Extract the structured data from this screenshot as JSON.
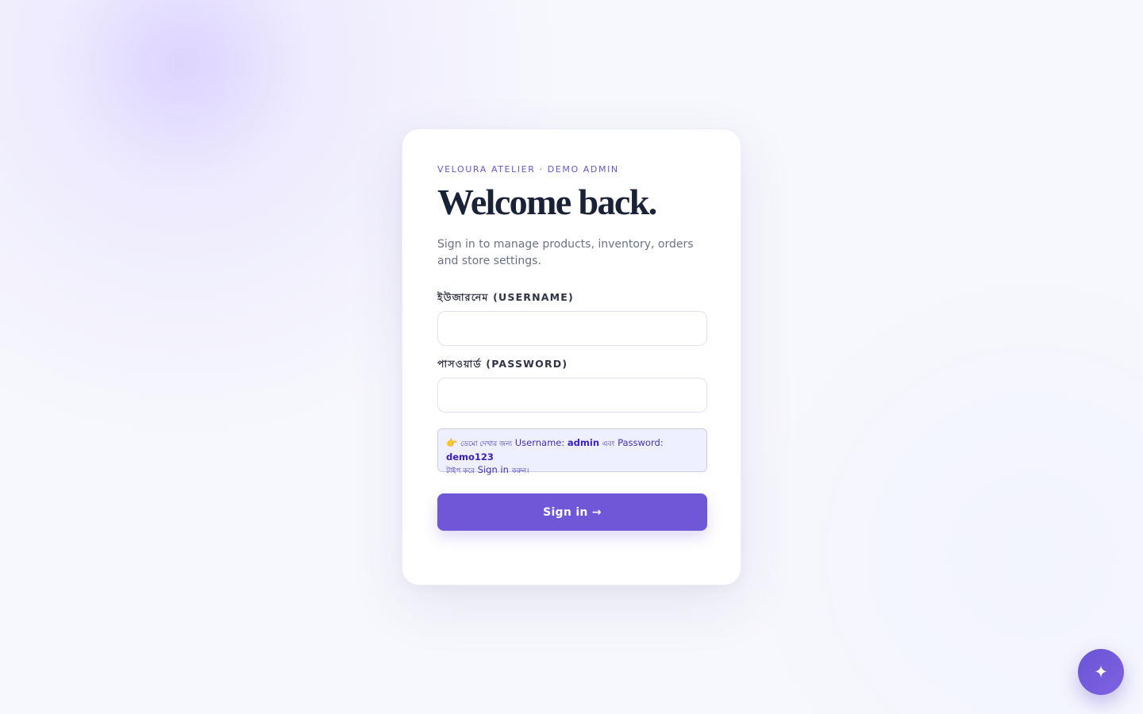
{
  "brand": {
    "eyebrow": "VELOURA ATELIER · DEMO ADMIN"
  },
  "login": {
    "title": "Welcome back.",
    "subtitle": "Sign in to manage products, inventory, orders and store settings.",
    "username": {
      "label": "ইউজারনেম (USERNAME)",
      "value": "",
      "placeholder": ""
    },
    "password": {
      "label": "পাসওয়ার্ড (PASSWORD)",
      "value": "",
      "placeholder": ""
    },
    "hint": {
      "pointer_icon": "👉",
      "part1": "ডেমো দেখার জন্য",
      "part2": "Username:",
      "username_value": "admin",
      "part3": "এবং",
      "part4": "Password:",
      "password_value": "demo123",
      "part5": "টাইপ করে",
      "part6": "Sign in",
      "part7": "করুন।"
    },
    "submit_label": "Sign in →"
  },
  "assistant": {
    "icon": "sparkle-icon",
    "glyph": "✦"
  },
  "colors": {
    "accent": "#6f57d7",
    "heading": "#1a2238",
    "eyebrow": "#6c56c8",
    "hint_bg": "#eef0ff"
  }
}
